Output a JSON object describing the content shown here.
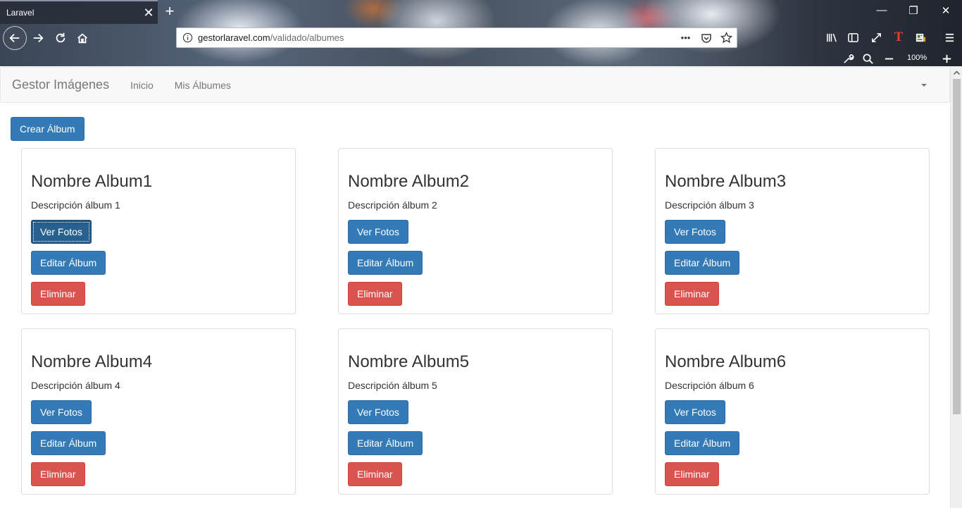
{
  "browser": {
    "tab_title": "Laravel",
    "url_host": "gestorlaravel.com",
    "url_path": "/validado/albumes",
    "zoom": "100%"
  },
  "navbar": {
    "brand": "Gestor Imágenes",
    "links": [
      "Inicio",
      "Mis Álbumes"
    ]
  },
  "create_button": "Crear Álbum",
  "albums": [
    {
      "title": "Nombre Album1",
      "description": "Descripción álbum 1"
    },
    {
      "title": "Nombre Album2",
      "description": "Descripción álbum 2"
    },
    {
      "title": "Nombre Album3",
      "description": "Descripción álbum 3"
    },
    {
      "title": "Nombre Album4",
      "description": "Descripción álbum 4"
    },
    {
      "title": "Nombre Album5",
      "description": "Descripción álbum 5"
    },
    {
      "title": "Nombre Album6",
      "description": "Descripción álbum 6"
    }
  ],
  "card_buttons": {
    "view": "Ver Fotos",
    "edit": "Editar Álbum",
    "delete": "Eliminar"
  },
  "colors": {
    "primary": "#337ab7",
    "danger": "#d9534f",
    "navbar_bg": "#f8f8f8"
  }
}
